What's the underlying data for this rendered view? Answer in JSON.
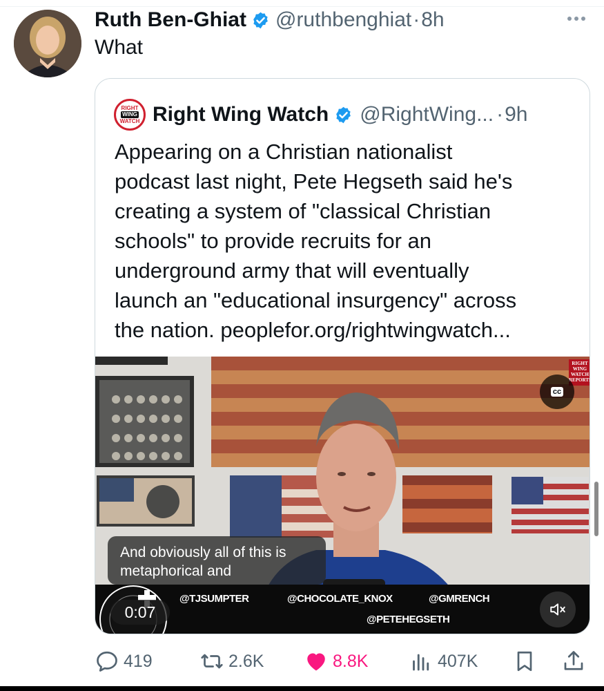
{
  "tweet": {
    "author_name": "Ruth Ben-Ghiat",
    "author_handle": "@ruthbenghiat",
    "separator": "·",
    "time": "8h",
    "text": "What"
  },
  "quoted_tweet": {
    "logo_top": "RIGHT",
    "logo_mid": "WING",
    "logo_bottom": "WATCH",
    "author_name": "Right Wing Watch",
    "author_handle": "@RightWing...",
    "separator": "·",
    "time": "9h",
    "lines": [
      "Appearing on a Christian nationalist",
      "podcast last night, Pete Hegseth said he's",
      "creating a system of \"classical Christian",
      "schools\" to provide recruits for an",
      "underground army that will eventually",
      "launch an \"educational insurgency\" across",
      "the nation. peoplefor.org/rightwingwatch..."
    ]
  },
  "video": {
    "cc_label": "cc",
    "badge_lines": [
      "RIGHT",
      "WING",
      "WATCH",
      "REPORTS"
    ],
    "caption_lines": [
      "And obviously all of this is",
      "metaphorical and"
    ],
    "time": "0:07",
    "tags": [
      "@TJSUMPTER",
      "@CHOCOLATE_KNOX",
      "@GMRENCH",
      "@PETEHEGSETH"
    ]
  },
  "actions": {
    "replies": "419",
    "retweets": "2.6K",
    "likes": "8.8K",
    "views": "407K"
  },
  "colors": {
    "accent": "#1d9bf0",
    "like": "#f91880",
    "muted": "#536471"
  },
  "icons": {
    "reply": "reply-icon",
    "retweet": "retweet-icon",
    "like": "heart-icon",
    "views": "views-icon",
    "bookmark": "bookmark-icon",
    "share": "share-icon"
  }
}
